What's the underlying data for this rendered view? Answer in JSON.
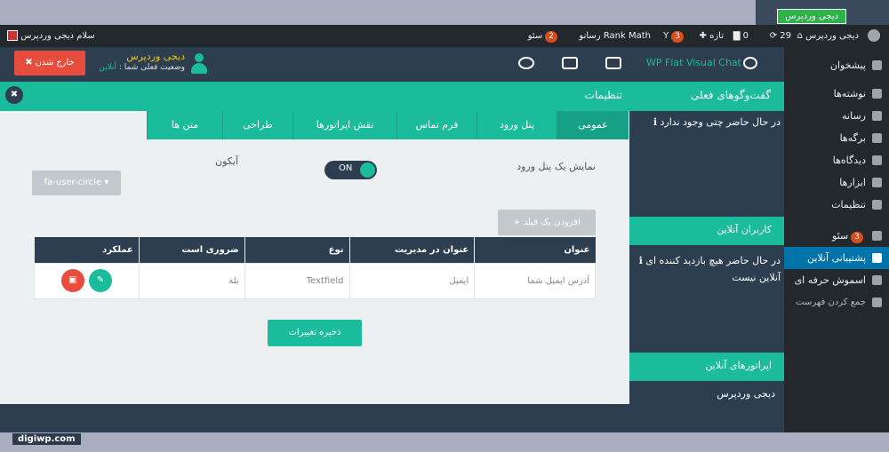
{
  "frame": {
    "badge": "دیجی وردپرس",
    "url": "digiwp.com"
  },
  "adminbar": {
    "greeting": "سلام دیجی وردپرس",
    "site_name": "دیجی وردپرس",
    "updates": "29",
    "comments": "0",
    "new_label": "تازه",
    "yoast_count": "3",
    "rankmath_label": "Rank Math",
    "seo_label": "رسانو",
    "seo2_label": "سئو",
    "seo2_count": "2"
  },
  "sidebar": {
    "items": [
      {
        "label": "پیشخوان",
        "icon": "dashboard-icon"
      },
      {
        "label": "نوشته‌ها",
        "icon": "pin-icon"
      },
      {
        "label": "رسانه",
        "icon": "media-icon"
      },
      {
        "label": "برگه‌ها",
        "icon": "pages-icon"
      },
      {
        "label": "دیدگاه‌ها",
        "icon": "comments-icon"
      },
      {
        "label": "ابزارها",
        "icon": "wrench-icon"
      },
      {
        "label": "تنظیمات",
        "icon": "settings-icon"
      },
      {
        "label": "سئو",
        "icon": "yoast-icon",
        "badge": "3"
      },
      {
        "label": "پشتیبانی آنلاین",
        "icon": "chat-icon"
      },
      {
        "label": "اسموش حرفه ای",
        "icon": "smush-icon"
      },
      {
        "label": "جمع کردن فهرست",
        "icon": "collapse-icon"
      }
    ]
  },
  "header": {
    "brand": "WP Flat Visual Chat",
    "user_name": "دیجی وردپرس",
    "status_label": "وضعیت فعلی شما :",
    "status_value": "آنلاین",
    "logout": "✖ خارج شدن"
  },
  "bar": {
    "chats_title": "گفت‌وگوهای فعلی",
    "settings_title": "تنظیمات"
  },
  "tabs": [
    "عمومی",
    "پنل ورود",
    "فرم تماس",
    "نقش اپراتورها",
    "طراحی",
    "متن ها"
  ],
  "form": {
    "show_panel_label": "نمایش یک پنل ورود",
    "toggle_state": "ON",
    "icon_label": "آیکون",
    "icon_value": "fa-user-circle ▾",
    "add_field": "+ افزودن یک فیلد",
    "save": "ذخیره تغییرات"
  },
  "table": {
    "headers": [
      "عنوان",
      "عنوان در مدیریت",
      "نوع",
      "ضروری است",
      "عملکرد"
    ],
    "rows": [
      {
        "title": "آدرس ایمیل شما",
        "admin_title": "ایمیل",
        "type": "Textfield",
        "required": "بله"
      }
    ]
  },
  "right": {
    "no_chat": "ℹ در حال حاضر چتی وجود ندارد",
    "online_users_title": "کاربران آنلاین",
    "online_users_text": "ℹ در حال حاضر هیچ بازدید کننده ای آنلاین نیست",
    "operators_title": "اپراتورهای آنلاین",
    "operator_name": "دیجی وردپرس"
  },
  "colors": {
    "teal": "#1abc9c",
    "dark": "#2c3e50",
    "red": "#e74c3c",
    "wp_dark": "#23282d",
    "wp_blue": "#0073aa"
  }
}
